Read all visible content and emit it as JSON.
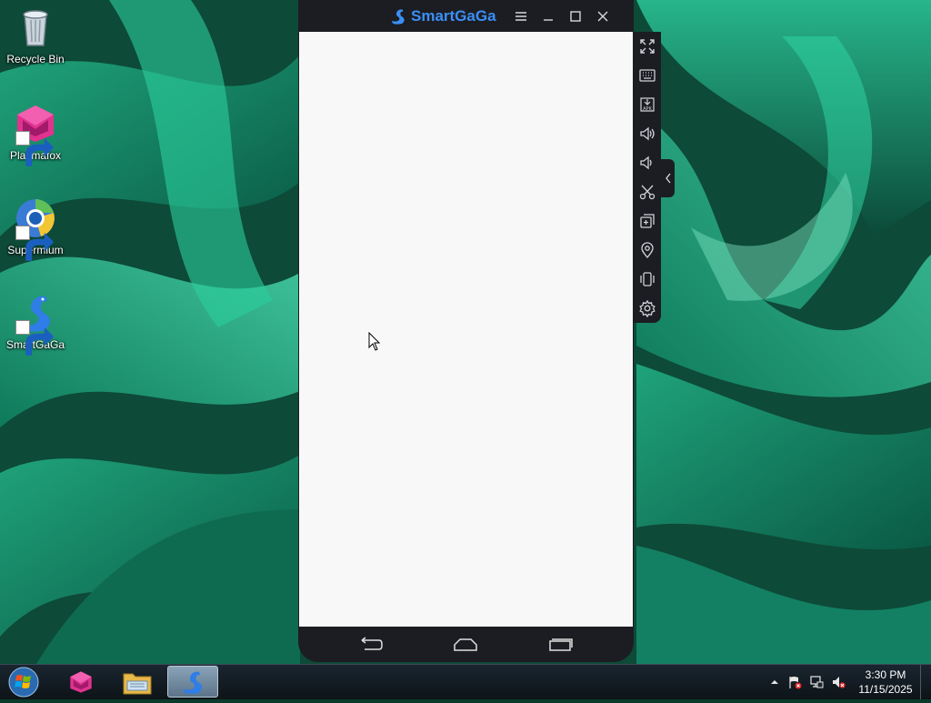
{
  "desktop": {
    "icons": [
      {
        "label": "Recycle Bin",
        "icon": "recycle-bin-icon"
      },
      {
        "label": "Plasmafox",
        "icon": "plasmafox-icon"
      },
      {
        "label": "Supermium",
        "icon": "supermium-icon"
      },
      {
        "label": "SmartGaGa",
        "icon": "smartgaga-icon"
      }
    ]
  },
  "emulator": {
    "title": "SmartGaGa",
    "accent_color": "#3a8ff6",
    "titlebar_buttons": [
      "menu-icon",
      "minimize-icon",
      "maximize-icon",
      "close-icon"
    ],
    "side_toolbar": [
      "fullscreen-icon",
      "keyboard-icon",
      "install-apk-icon",
      "volume-up-icon",
      "volume-down-icon",
      "screenshot-scissors-icon",
      "multi-instance-icon",
      "location-icon",
      "shake-icon",
      "settings-icon"
    ],
    "apk_label": "APK",
    "nav_buttons": [
      "back-icon",
      "home-icon",
      "recents-icon"
    ]
  },
  "taskbar": {
    "items": [
      "plasmafox-icon",
      "file-explorer-icon",
      "smartgaga-icon"
    ],
    "tray": [
      "show-hidden-icons-icon",
      "action-center-flag-icon",
      "network-icon",
      "volume-muted-icon"
    ],
    "time": "3:30 PM",
    "date": "11/15/2025"
  }
}
